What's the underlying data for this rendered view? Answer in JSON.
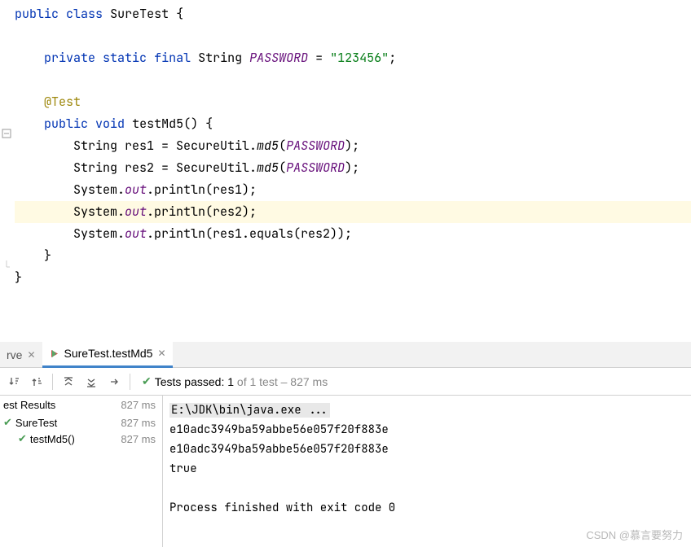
{
  "code": {
    "lines": [
      {
        "indent": 0,
        "segments": [
          [
            "kw",
            "public"
          ],
          [
            "p",
            " "
          ],
          [
            "kw",
            "class"
          ],
          [
            "p",
            " "
          ],
          [
            "type",
            "SureTest"
          ],
          [
            "p",
            " {"
          ]
        ]
      },
      {
        "indent": 0,
        "segments": []
      },
      {
        "indent": 1,
        "segments": [
          [
            "kw",
            "private"
          ],
          [
            "p",
            " "
          ],
          [
            "kw",
            "static"
          ],
          [
            "p",
            " "
          ],
          [
            "kw",
            "final"
          ],
          [
            "p",
            " "
          ],
          [
            "type",
            "String"
          ],
          [
            "p",
            " "
          ],
          [
            "fld-static",
            "PASSWORD"
          ],
          [
            "p",
            " = "
          ],
          [
            "str",
            "\"123456\""
          ],
          [
            "p",
            ";"
          ]
        ]
      },
      {
        "indent": 0,
        "segments": []
      },
      {
        "indent": 1,
        "segments": [
          [
            "ann",
            "@Test"
          ]
        ]
      },
      {
        "indent": 1,
        "segments": [
          [
            "kw",
            "public"
          ],
          [
            "p",
            " "
          ],
          [
            "kw",
            "void"
          ],
          [
            "p",
            " "
          ],
          [
            "type",
            "testMd5"
          ],
          [
            "p",
            "() {"
          ]
        ]
      },
      {
        "indent": 2,
        "segments": [
          [
            "type",
            "String"
          ],
          [
            "p",
            " res1 = SecureUtil."
          ],
          [
            "mtd-static",
            "md5"
          ],
          [
            "p",
            "("
          ],
          [
            "fld-static",
            "PASSWORD"
          ],
          [
            "p",
            ");"
          ]
        ]
      },
      {
        "indent": 2,
        "segments": [
          [
            "type",
            "String"
          ],
          [
            "p",
            " res2 = SecureUtil."
          ],
          [
            "mtd-static",
            "md5"
          ],
          [
            "p",
            "("
          ],
          [
            "fld-static",
            "PASSWORD"
          ],
          [
            "p",
            ");"
          ]
        ]
      },
      {
        "indent": 2,
        "segments": [
          [
            "p",
            "System."
          ],
          [
            "fld-static",
            "out"
          ],
          [
            "p",
            ".println(res1);"
          ]
        ]
      },
      {
        "indent": 2,
        "highlighted": true,
        "segments": [
          [
            "p",
            "System."
          ],
          [
            "fld-static",
            "out"
          ],
          [
            "p",
            ".println(res2);"
          ]
        ]
      },
      {
        "indent": 2,
        "segments": [
          [
            "p",
            "System."
          ],
          [
            "fld-static",
            "out"
          ],
          [
            "p",
            ".println(res1.equals(res2));"
          ]
        ]
      },
      {
        "indent": 1,
        "segments": [
          [
            "p",
            "}"
          ]
        ]
      },
      {
        "indent": 0,
        "segments": [
          [
            "p",
            "}"
          ]
        ]
      }
    ]
  },
  "tabs": {
    "inactive": "rve",
    "active": "SureTest.testMd5"
  },
  "toolbar": {
    "tests_passed_prefix": "Tests passed: ",
    "tests_passed_count": "1",
    "tests_passed_suffix_muted": " of 1 test – 827 ms"
  },
  "tree": {
    "header_label": "est Results",
    "header_ms": "827 ms",
    "items": [
      {
        "label": "SureTest",
        "ms": "827 ms",
        "indent": 0
      },
      {
        "label": "testMd5()",
        "ms": "827 ms",
        "indent": 1
      }
    ]
  },
  "console": {
    "cmd": "E:\\JDK\\bin\\java.exe ...",
    "lines": [
      "e10adc3949ba59abbe56e057f20f883e",
      "e10adc3949ba59abbe56e057f20f883e",
      "true"
    ],
    "exitmsg": "Process finished with exit code 0"
  },
  "watermark": "CSDN @慕言要努力"
}
